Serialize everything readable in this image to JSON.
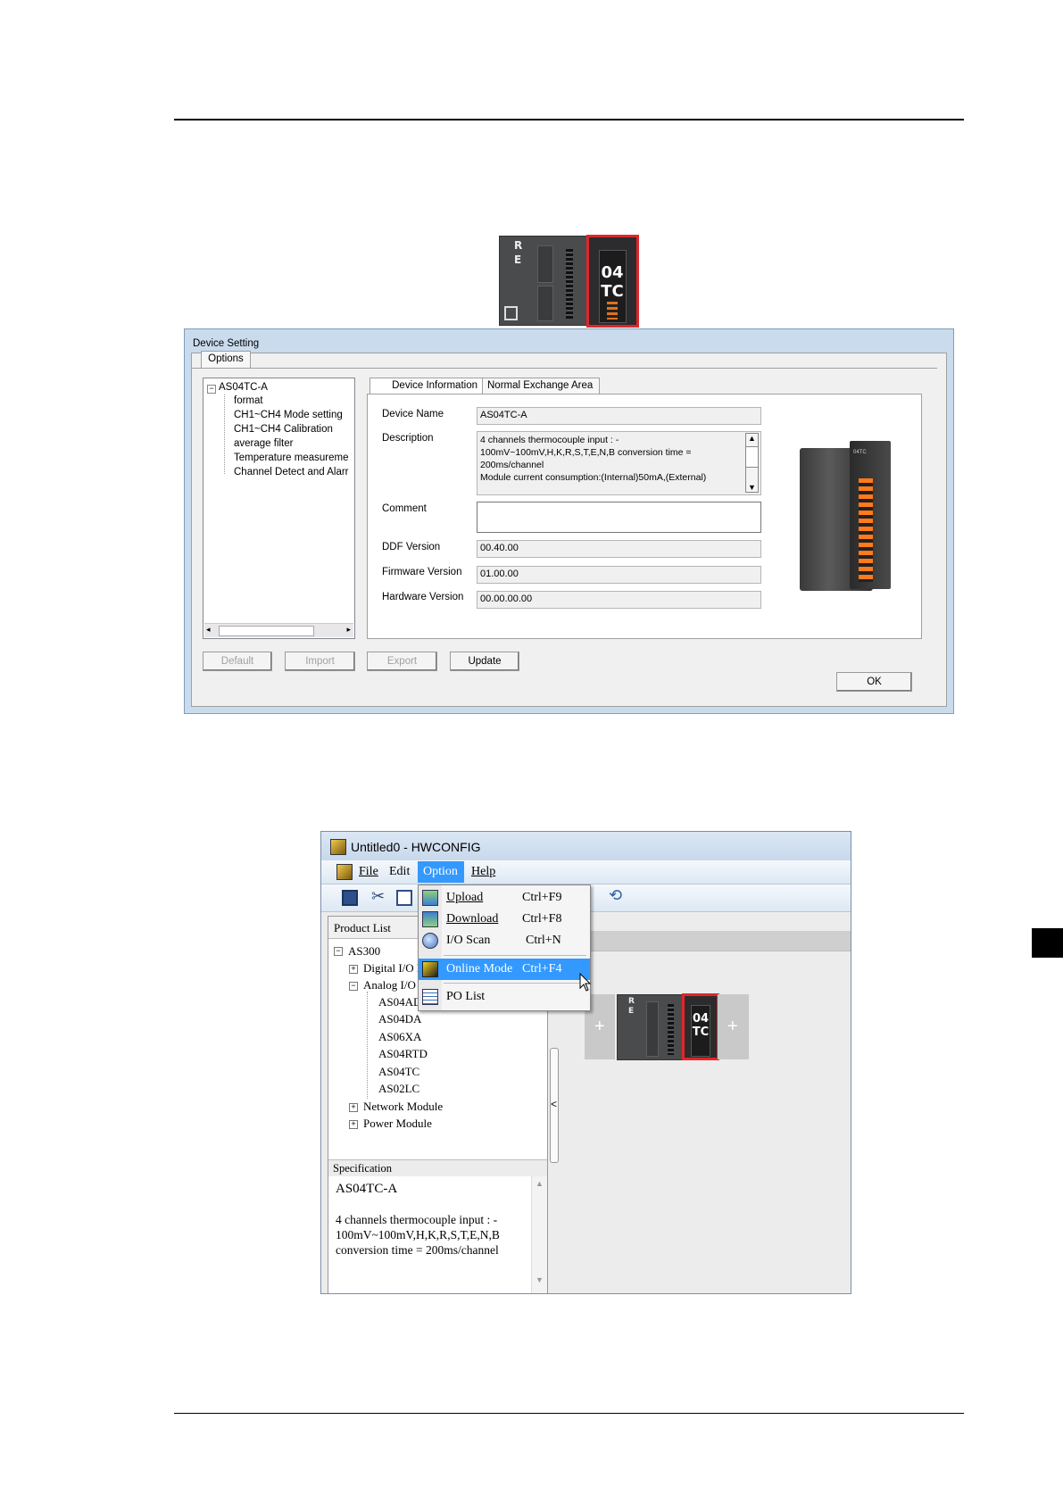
{
  "dialog": {
    "title": "Device Setting",
    "options_tab": "Options",
    "tree": {
      "root": "AS04TC-A",
      "items": [
        "format",
        "CH1~CH4 Mode setting",
        "CH1~CH4 Calibration",
        "average filter",
        "Temperature measureme",
        "Channel Detect and Alarr"
      ]
    },
    "tabs": [
      "Device Information",
      "Normal Exchange Area"
    ],
    "labels": {
      "device_name": "Device Name",
      "description": "Description",
      "comment": "Comment",
      "ddf_version": "DDF Version",
      "firmware_version": "Firmware Version",
      "hardware_version": "Hardware Version"
    },
    "values": {
      "device_name": "AS04TC-A",
      "description_lines": [
        "4 channels thermocouple input : -",
        "100mV~100mV,H,K,R,S,T,E,N,B conversion time =",
        "200ms/channel",
        "Module current consumption:(Internal)50mA,(External)"
      ],
      "comment": "",
      "ddf_version": "00.40.00",
      "firmware_version": "01.00.00",
      "hardware_version": "00.00.00.00"
    },
    "buttons": {
      "default": "Default",
      "import": "Import",
      "export": "Export",
      "update": "Update",
      "ok": "OK"
    }
  },
  "module_pictures": {
    "cpu_letters": [
      "R",
      "E"
    ],
    "tc_number": "04",
    "tc_letters": "TC",
    "product_label": "04TC"
  },
  "hwconfig": {
    "title": "Untitled0 - HWCONFIG",
    "menubar": [
      "File",
      "Edit",
      "Option",
      "Help"
    ],
    "option_menu": [
      {
        "label": "Upload",
        "shortcut": "Ctrl+F9",
        "icon": "upload-icon"
      },
      {
        "label": "Download",
        "shortcut": "Ctrl+F8",
        "icon": "download-icon"
      },
      {
        "label": "I/O Scan",
        "shortcut": "Ctrl+N",
        "icon": "io-scan-icon"
      },
      {
        "label": "Online Mode",
        "shortcut": "Ctrl+F4",
        "icon": "online-mode-icon"
      },
      {
        "label": "PO List",
        "shortcut": "",
        "icon": "po-list-icon"
      }
    ],
    "product_list_label": "Product List",
    "tree": {
      "root": "AS300",
      "digital": "Digital I/O M",
      "analog": "Analog I/O I",
      "analog_items": [
        "AS04AD",
        "AS04DA",
        "AS06XA",
        "AS04RTD",
        "AS04TC",
        "AS02LC"
      ],
      "network": "Network Module",
      "power": "Power Module"
    },
    "specification_label": "Specification",
    "spec": {
      "name": "AS04TC-A",
      "lines": [
        "4 channels thermocouple input : -",
        "100mV~100mV,H,K,R,S,T,E,N,B",
        "conversion time = 200ms/channel"
      ]
    },
    "slot_plus": "+",
    "collapse_arrow": "<"
  },
  "colors": {
    "highlight_red": "#e0262a",
    "menu_selected": "#3399ff",
    "dialog_frame": "#c9dbed"
  }
}
